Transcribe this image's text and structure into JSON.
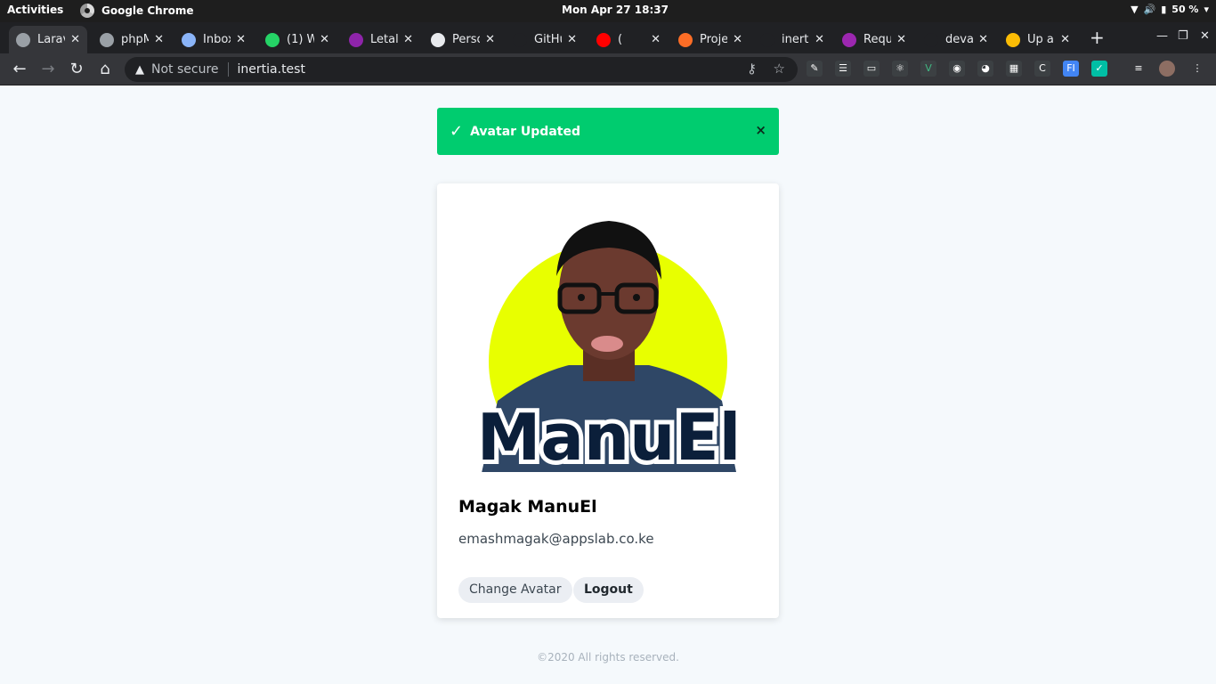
{
  "system_bar": {
    "activities": "Activities",
    "app_name": "Google Chrome",
    "clock": "Mon Apr 27  18:37",
    "battery": "50 %"
  },
  "tabs": [
    {
      "title": "Larav",
      "favicon": "globe-icon",
      "color": "#9aa0a6",
      "active": true
    },
    {
      "title": "phpM",
      "favicon": "globe-icon",
      "color": "#9aa0a6"
    },
    {
      "title": "Inbox",
      "favicon": "mail-icon",
      "color": "#8ab4f8"
    },
    {
      "title": "(1) W",
      "favicon": "whatsapp-icon",
      "color": "#25d366"
    },
    {
      "title": "Letal",
      "favicon": "letal-icon",
      "color": "#8e24aa"
    },
    {
      "title": "Perso",
      "favicon": "trello-icon",
      "color": "#e8eaed"
    },
    {
      "title": "GitHu",
      "favicon": "github-icon",
      "color": "#202124"
    },
    {
      "title": "(",
      "favicon": "youtube-icon",
      "color": "#ff0000"
    },
    {
      "title": "Proje",
      "favicon": "gitlab-icon",
      "color": "#fc6d26"
    },
    {
      "title": "inerti",
      "favicon": "inertia-icon",
      "color": "#202124"
    },
    {
      "title": "Requ",
      "favicon": "requests-icon",
      "color": "#9c27b0"
    },
    {
      "title": "deva",
      "favicon": "dev-icon",
      "color": "#202124"
    },
    {
      "title": "Up a",
      "favicon": "colorful-icon",
      "color": "#fbbc05"
    }
  ],
  "omnibox": {
    "security": "Not secure",
    "url": "inertia.test"
  },
  "flash": {
    "message": "Avatar Updated",
    "close": "×"
  },
  "profile": {
    "avatar_text": "ManuEl",
    "name": "Magak ManuEl",
    "email": "emashmagak@appslab.co.ke",
    "change_avatar_label": "Change Avatar",
    "logout_label": "Logout"
  },
  "footer": {
    "text": "©2020 All rights reserved."
  },
  "colors": {
    "flash_bg": "#00cc6f",
    "avatar_circle": "#e8ff00",
    "avatar_text": "#0b1f3a"
  }
}
